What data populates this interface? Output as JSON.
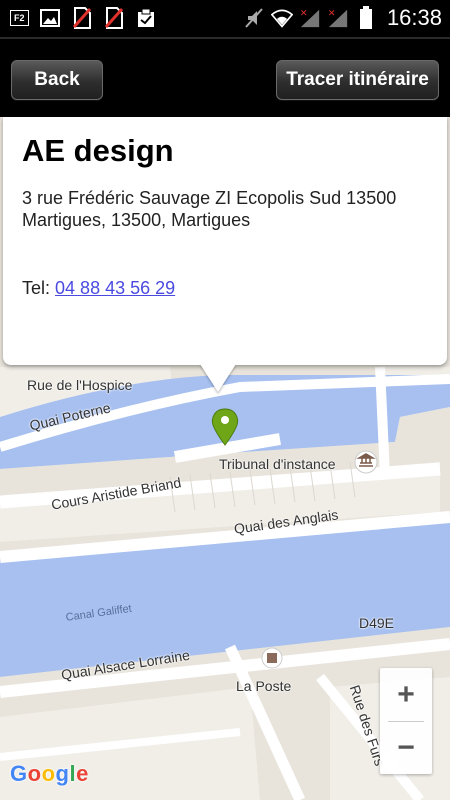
{
  "status_bar": {
    "time": "16:38",
    "left_icons": [
      "f2-icon",
      "image-icon",
      "no-sim-icon",
      "no-sim-icon",
      "clipboard-check-icon"
    ],
    "f2_label": "F2",
    "right_icons": [
      "mute-icon",
      "wifi-icon",
      "signal-icon",
      "signal-icon",
      "battery-icon"
    ]
  },
  "action_bar": {
    "back_label": "Back",
    "route_label": "Tracer itinéraire"
  },
  "info_window": {
    "title": "AE design",
    "address": "3 rue Frédéric Sauvage ZI Ecopolis Sud 13500 Martigues, 13500, Martigues",
    "tel_label": "Tel:",
    "tel_number": "04 88 43 56 29"
  },
  "map": {
    "labels": {
      "rue_hospice": "Rue de l'Hospice",
      "quai_poterne": "Quai Poterne",
      "tribunal": "Tribunal d'instance",
      "cours_aristide": "Cours Aristide Briand",
      "quai_anglais": "Quai des Anglais",
      "canal_galiffet": "Canal Galiffet",
      "d49e": "D49E",
      "quai_alsace": "Quai Alsace Lorraine",
      "la_poste": "La Poste",
      "rue_des_furs": "Rue des Furs"
    },
    "colors": {
      "water": "#a7c0f0",
      "land": "#e8e4dc",
      "road": "#ffffff",
      "marker": "#6fa617"
    },
    "zoom_in": "+",
    "zoom_out": "−",
    "logo": "Google"
  }
}
